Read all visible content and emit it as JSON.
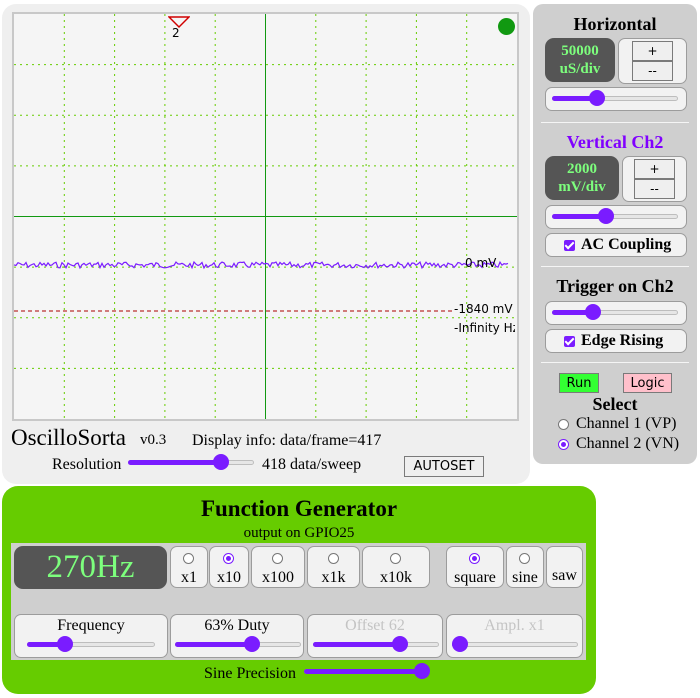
{
  "scope": {
    "app_title": "OscilloSorta",
    "version": "v0.3",
    "display_info": "Display info: data/frame=417",
    "resolution_label": "Resolution",
    "resolution_value": "418 data/sweep",
    "resolution_level": 0.77,
    "autoset_label": "AUTOSET",
    "trigger_marker_label": "2",
    "zero_label": "0 mV",
    "trigger_level_label": "-1840 mV",
    "frequency_readout": "-Infinity Hz",
    "status_color": "#119911",
    "trace_color": "#7a1cff",
    "grid_color": "#66cc00",
    "axis_color": "#119911",
    "trigger_line_color": "#aa0000"
  },
  "horizontal": {
    "title": "Horizontal",
    "value_line1": "50000",
    "value_line2": "uS/div",
    "plus_label": "+",
    "minus_label": "--",
    "slider_level": 0.34
  },
  "vertical": {
    "title": "Vertical Ch2",
    "title_color": "#8000ff",
    "value_line1": "2000",
    "value_line2": "mV/div",
    "plus_label": "+",
    "minus_label": "--",
    "slider_level": 0.42,
    "ac_coupling_label": "AC Coupling",
    "ac_coupling_checked": true
  },
  "trigger": {
    "title": "Trigger on Ch2",
    "slider_level": 0.3,
    "edge_label": "Edge Rising",
    "edge_checked": true
  },
  "controls": {
    "run_label": "Run",
    "logic_label": "Logic",
    "select_title": "Select",
    "channel1_label": "Channel 1 (VP)",
    "channel2_label": "Channel 2 (VN)",
    "selected_channel": 2
  },
  "function_generator": {
    "title": "Function Generator",
    "subtitle": "output on GPIO25",
    "frequency_display": "270Hz",
    "multipliers": [
      "x1",
      "x10",
      "x100",
      "x1k",
      "x10k"
    ],
    "selected_multiplier": "x10",
    "waveforms": [
      "square",
      "sine",
      "saw"
    ],
    "selected_waveform": "square",
    "frequency_label": "Frequency",
    "frequency_level": 0.27,
    "duty_label": "63% Duty",
    "duty_level": 0.63,
    "offset_label": "Offset 62",
    "offset_level": 0.72,
    "amplitude_label": "Ampl. x1",
    "amplitude_level": 0.0,
    "sine_precision_label": "Sine Precision",
    "sine_precision_level": 1.0
  }
}
